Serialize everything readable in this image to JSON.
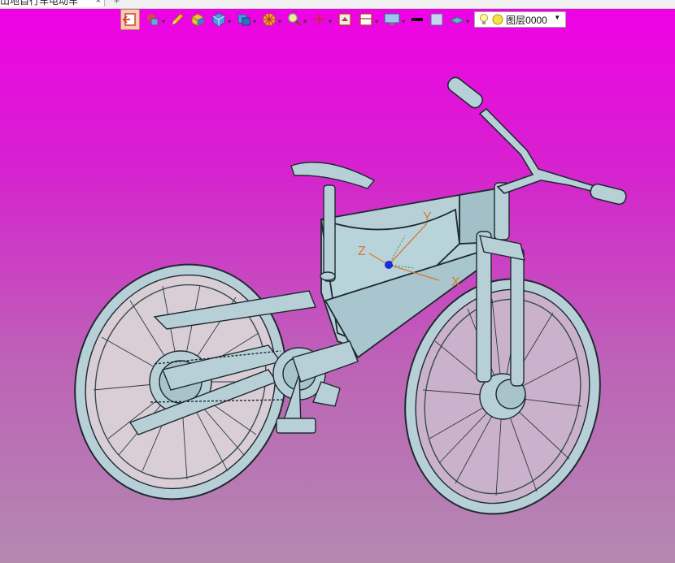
{
  "window": {
    "doc_tab_title": "山地自行车电动车",
    "doc_tab_close": "×",
    "new_tab": "+"
  },
  "toolbar": {
    "items": [
      {
        "icon": "exit-sketch-icon",
        "active": true,
        "dropdown": false
      },
      {
        "icon": "display-style-icon",
        "active": false,
        "dropdown": true
      },
      {
        "icon": "pencil-icon",
        "active": false,
        "dropdown": false
      },
      {
        "icon": "box-solid-icon",
        "active": false,
        "dropdown": false
      },
      {
        "icon": "cube-view-icon",
        "active": false,
        "dropdown": true
      },
      {
        "icon": "named-view-icon",
        "active": false,
        "dropdown": true
      },
      {
        "icon": "appearance-wheel-icon",
        "active": false,
        "dropdown": true
      },
      {
        "icon": "zoom-icon",
        "active": false,
        "dropdown": true
      },
      {
        "icon": "triad-axis-icon",
        "active": false,
        "dropdown": true
      },
      {
        "icon": "section-view-icon",
        "active": false,
        "dropdown": false
      },
      {
        "icon": "hide-show-icon",
        "active": false,
        "dropdown": true
      },
      {
        "icon": "monitor-display-icon",
        "active": false,
        "dropdown": true
      },
      {
        "icon": "line-color-icon",
        "active": false,
        "dropdown": false
      },
      {
        "icon": "fill-color-icon",
        "active": false,
        "dropdown": false
      },
      {
        "icon": "layer-plane-icon",
        "active": false,
        "dropdown": true
      }
    ],
    "layer_combo": {
      "value": "图层0000",
      "icons": [
        "lightbulb-icon",
        "sun-icon"
      ]
    }
  },
  "viewport": {
    "model": "mountain-ebike-wireframe",
    "triad": {
      "x_label": "X",
      "y_label": "Y",
      "z_label": "Z"
    },
    "colors": {
      "bg_top": "#f000e6",
      "bg_bottom": "#b389b0",
      "model_fill": "#b7d0d8",
      "model_stroke": "#1d2a2e",
      "triad_x": "#d9782e",
      "triad_y": "#d9782e",
      "triad_z": "#d9782e",
      "triad_origin": "#1a2bd8"
    }
  }
}
